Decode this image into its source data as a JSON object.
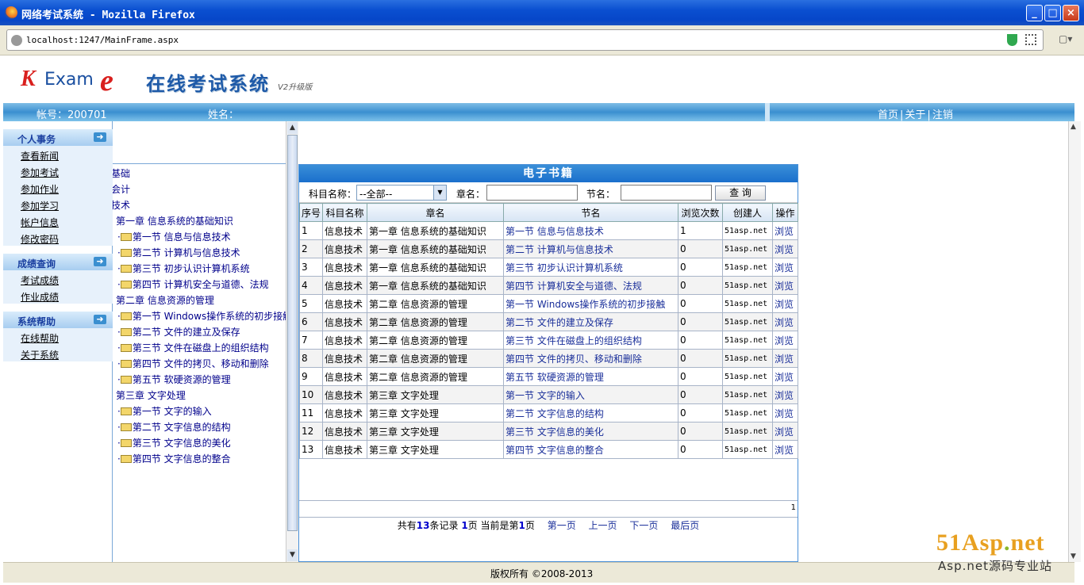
{
  "window": {
    "title": "网络考试系统 - Mozilla Firefox",
    "min": "_",
    "max": "□",
    "close": "×"
  },
  "browser": {
    "url": "localhost:1247/MainFrame.aspx"
  },
  "header": {
    "logo_k": "K",
    "logo_exam": "Exam",
    "logo_e": "e",
    "title": "在线考试系统",
    "version": "V2升级版"
  },
  "infobar": {
    "account": "帐号：200701",
    "name": "姓名：",
    "links": [
      "首页",
      "关于",
      "注销"
    ]
  },
  "leftnav": [
    {
      "title": "个人事务",
      "items": [
        "查看新闻",
        "参加考试",
        "参加作业",
        "参加学习",
        "帐户信息",
        "修改密码"
      ]
    },
    {
      "title": "成绩查询",
      "items": [
        "考试成绩",
        "作业成绩"
      ]
    },
    {
      "title": "系统帮助",
      "items": [
        "在线帮助",
        "关于系统"
      ]
    }
  ],
  "tree": {
    "nodes": [
      {
        "t": "基础",
        "lvl": 0
      },
      {
        "t": "会计",
        "lvl": 0
      },
      {
        "t": "技术",
        "lvl": 0
      },
      {
        "t": "第一章 信息系统的基础知识",
        "lvl": 1
      },
      {
        "t": "第一节 信息与信息技术",
        "lvl": 2
      },
      {
        "t": "第二节 计算机与信息技术",
        "lvl": 2
      },
      {
        "t": "第三节 初步认识计算机系统",
        "lvl": 2
      },
      {
        "t": "第四节 计算机安全与道德、法规",
        "lvl": 2
      },
      {
        "t": "第二章 信息资源的管理",
        "lvl": 1
      },
      {
        "t": "第一节 Windows操作系统的初步接触",
        "lvl": 2
      },
      {
        "t": "第二节 文件的建立及保存",
        "lvl": 2
      },
      {
        "t": "第三节 文件在磁盘上的组织结构",
        "lvl": 2
      },
      {
        "t": "第四节 文件的拷贝、移动和删除",
        "lvl": 2
      },
      {
        "t": "第五节 软硬资源的管理",
        "lvl": 2
      },
      {
        "t": "第三章 文字处理",
        "lvl": 1
      },
      {
        "t": "第一节 文字的输入",
        "lvl": 2
      },
      {
        "t": "第二节 文字信息的结构",
        "lvl": 2
      },
      {
        "t": "第三节 文字信息的美化",
        "lvl": 2
      },
      {
        "t": "第四节 文字信息的整合",
        "lvl": 2
      }
    ]
  },
  "ebook": {
    "title": "电子书籍",
    "filter": {
      "subject_label": "科目名称：",
      "subject_value": "--全部--",
      "chapter_label": "章名：",
      "section_label": "节名：",
      "search": "查 询"
    },
    "columns": [
      "序号",
      "科目名称",
      "章名",
      "节名",
      "浏览次数",
      "创建人",
      "操作"
    ],
    "rows": [
      [
        "1",
        "信息技术",
        "第一章 信息系统的基础知识",
        "第一节 信息与信息技术",
        "1",
        "51asp.net",
        "浏览"
      ],
      [
        "2",
        "信息技术",
        "第一章 信息系统的基础知识",
        "第二节 计算机与信息技术",
        "0",
        "51asp.net",
        "浏览"
      ],
      [
        "3",
        "信息技术",
        "第一章 信息系统的基础知识",
        "第三节 初步认识计算机系统",
        "0",
        "51asp.net",
        "浏览"
      ],
      [
        "4",
        "信息技术",
        "第一章 信息系统的基础知识",
        "第四节 计算机安全与道德、法规",
        "0",
        "51asp.net",
        "浏览"
      ],
      [
        "5",
        "信息技术",
        "第二章 信息资源的管理",
        "第一节 Windows操作系统的初步接触",
        "0",
        "51asp.net",
        "浏览"
      ],
      [
        "6",
        "信息技术",
        "第二章 信息资源的管理",
        "第二节 文件的建立及保存",
        "0",
        "51asp.net",
        "浏览"
      ],
      [
        "7",
        "信息技术",
        "第二章 信息资源的管理",
        "第三节 文件在磁盘上的组织结构",
        "0",
        "51asp.net",
        "浏览"
      ],
      [
        "8",
        "信息技术",
        "第二章 信息资源的管理",
        "第四节 文件的拷贝、移动和删除",
        "0",
        "51asp.net",
        "浏览"
      ],
      [
        "9",
        "信息技术",
        "第二章 信息资源的管理",
        "第五节 软硬资源的管理",
        "0",
        "51asp.net",
        "浏览"
      ],
      [
        "10",
        "信息技术",
        "第三章 文字处理",
        "第一节 文字的输入",
        "0",
        "51asp.net",
        "浏览"
      ],
      [
        "11",
        "信息技术",
        "第三章 文字处理",
        "第二节 文字信息的结构",
        "0",
        "51asp.net",
        "浏览"
      ],
      [
        "12",
        "信息技术",
        "第三章 文字处理",
        "第三节 文字信息的美化",
        "0",
        "51asp.net",
        "浏览"
      ],
      [
        "13",
        "信息技术",
        "第三章 文字处理",
        "第四节 文字信息的整合",
        "0",
        "51asp.net",
        "浏览"
      ]
    ],
    "page_num": "1",
    "pager": {
      "p1": "共有",
      "total": "13",
      "p2": "条记录",
      "pages": "1",
      "p3": "页 当前是第",
      "cur": "1",
      "p4": "页",
      "first": "第一页",
      "prev": "上一页",
      "next": "下一页",
      "last": "最后页"
    }
  },
  "footer": {
    "copyright": "版权所有 ©2008-2013"
  },
  "watermark": {
    "a": "51Asp",
    "dot": ".",
    "b": "net",
    "sub": "Asp.net源码专业站"
  }
}
